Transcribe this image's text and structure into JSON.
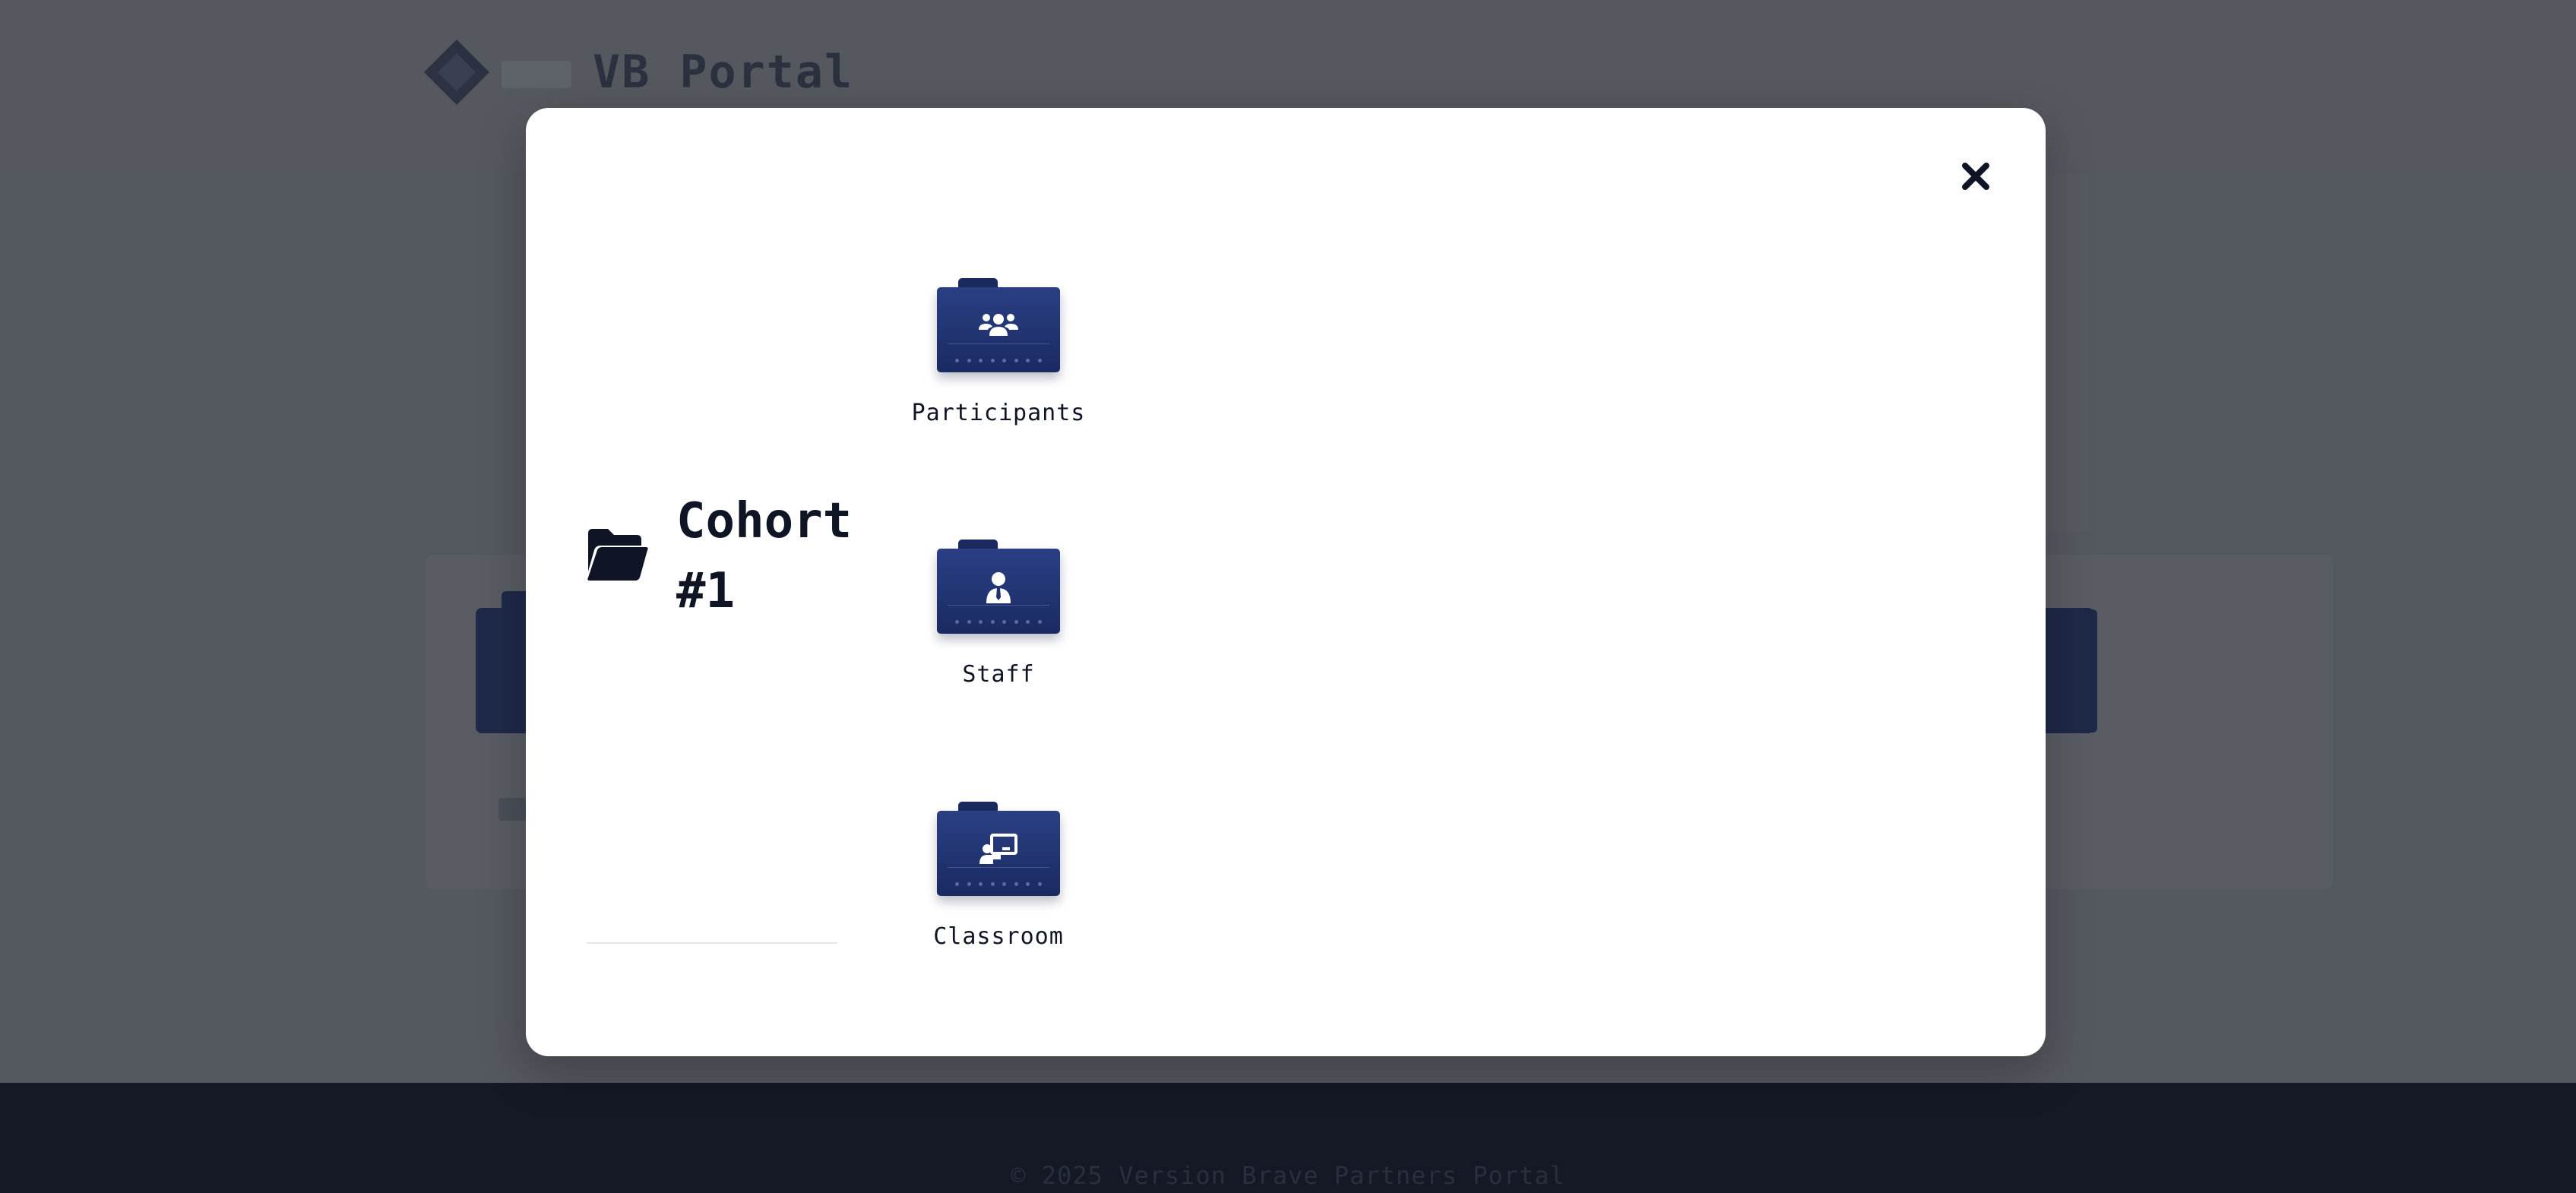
{
  "background": {
    "app_title": "VB Portal",
    "footer_text": "© 2025 Version Brave Partners Portal"
  },
  "modal": {
    "title": "Cohort #1",
    "close_icon": "close-icon",
    "folder_icon": "folder-open-icon",
    "tiles": [
      {
        "label": "Participants",
        "icon": "users-icon"
      },
      {
        "label": "Staff",
        "icon": "staff-user-icon"
      },
      {
        "label": "Classroom",
        "icon": "classroom-icon"
      }
    ]
  },
  "colors": {
    "overlay": "#54585f",
    "folder_dark": "#1a2a62",
    "folder_light": "#2a3f84",
    "text_dark": "#0f1524"
  }
}
